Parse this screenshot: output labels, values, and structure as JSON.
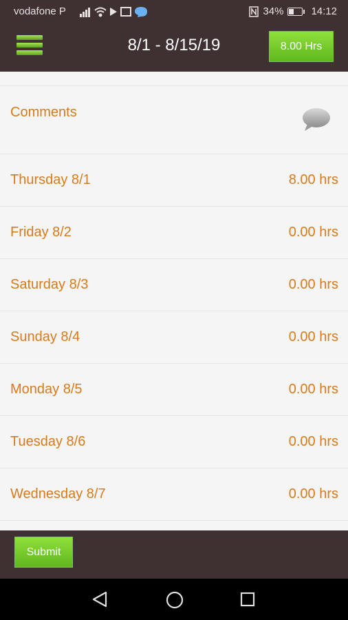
{
  "status_bar": {
    "carrier": "vodafone P",
    "battery": "34%",
    "time": "14:12",
    "icons": [
      "signal-icon",
      "wifi-icon",
      "play-icon",
      "photo-icon",
      "messenger-icon",
      "nfc-icon",
      "battery-icon"
    ]
  },
  "header": {
    "title": "8/1 - 8/15/19",
    "total_hours": "8.00 Hrs",
    "menu_icon": "hamburger-icon"
  },
  "comments": {
    "label": "Comments",
    "icon": "speech-bubble-icon"
  },
  "days": [
    {
      "label": "Thursday 8/1",
      "hours": "8.00 hrs"
    },
    {
      "label": "Friday 8/2",
      "hours": "0.00 hrs"
    },
    {
      "label": "Saturday 8/3",
      "hours": "0.00 hrs"
    },
    {
      "label": "Sunday 8/4",
      "hours": "0.00 hrs"
    },
    {
      "label": "Monday 8/5",
      "hours": "0.00 hrs"
    },
    {
      "label": "Tuesday 8/6",
      "hours": "0.00 hrs"
    },
    {
      "label": "Wednesday 8/7",
      "hours": "0.00 hrs"
    }
  ],
  "footer": {
    "submit_label": "Submit"
  },
  "colors": {
    "bar_bg": "#3f3032",
    "accent_green": "#6cc82a",
    "text_orange": "#d97a1a",
    "list_bg": "#f5f5f5"
  }
}
